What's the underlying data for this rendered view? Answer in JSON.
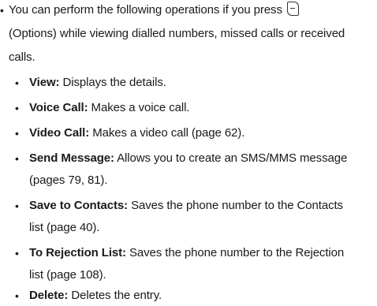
{
  "intro": {
    "line1": "You can perform the following operations if you press",
    "key_icon": "options-softkey-icon",
    "line2": "(Options) while viewing dialled numbers, missed calls or received",
    "line3": "calls."
  },
  "items": [
    {
      "term": "View:",
      "desc1": " Displays the details.",
      "desc2": ""
    },
    {
      "term": "Voice Call:",
      "desc1": " Makes a voice call.",
      "desc2": ""
    },
    {
      "term": "Video Call:",
      "desc1": " Makes a video call (page 62).",
      "desc2": ""
    },
    {
      "term": "Send Message:",
      "desc1": " Allows you to create an SMS/MMS message",
      "desc2": "(pages 79, 81)."
    },
    {
      "term": "Save to Contacts:",
      "desc1": " Saves the phone number to the Contacts",
      "desc2": "list (page 40)."
    },
    {
      "term": "To Rejection List:",
      "desc1": " Saves the phone number to the Rejection",
      "desc2": "list (page 108)."
    },
    {
      "term": "Delete:",
      "desc1": " Deletes the entry.",
      "desc2": ""
    }
  ]
}
